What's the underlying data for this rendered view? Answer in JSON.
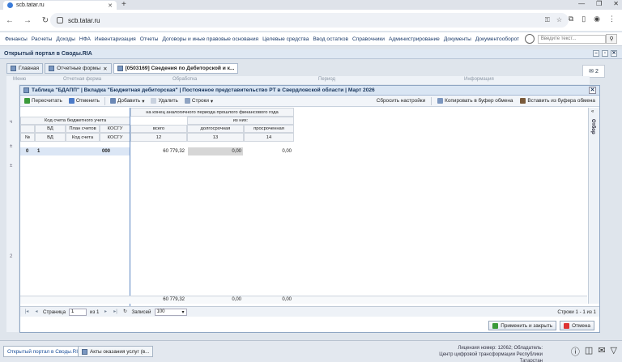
{
  "browser": {
    "tab_title": "scb.tatar.ru",
    "url": "scb.tatar.ru",
    "new_tab": "+"
  },
  "appnav": {
    "items": [
      "Финансы",
      "Расчеты",
      "Доходы",
      "НФА",
      "Инвентаризация",
      "Отчеты",
      "Договоры и иные правовые основания",
      "Целевые средства",
      "Ввод остатков",
      "Справочники",
      "Администрирование",
      "Документы",
      "Документооборот"
    ],
    "search_placeholder": "Введите текст..."
  },
  "portal_title": "Открытый портал в Своды.RIA",
  "inner_tabs": [
    {
      "label": "Главная"
    },
    {
      "label": "Отчетные формы"
    },
    {
      "label": "[0503169] Сведения по Дебиторской и к..."
    }
  ],
  "messages_count": "2",
  "bg_headers": [
    "Меню",
    "Отчетная форма",
    "Обработка",
    "Период",
    "Информация"
  ],
  "window": {
    "title": "Таблица \"БДАПП\" | Вкладка \"Бюджетная дебиторская\" | Постоянное представительство РТ в Свердловской области | Март 2026",
    "toolbar": {
      "recalc": "Пересчитать",
      "undo": "Отменить",
      "add": "Добавить",
      "delete": "Удалить",
      "rows": "Строки",
      "reset": "Сбросить настройки",
      "copy": "Копировать в буфер обмена",
      "paste": "Вставить из буфера обмена"
    },
    "side_label": "Отбор",
    "grid": {
      "group_top": "на конец аналогичного периода прошлого финансового года",
      "group_left": "Код счета бюджетного учета",
      "sub_of_which": "из них:",
      "col_num": "№",
      "col_vd": "ВД",
      "col_plan": "План счетов",
      "col_kosgu": "КОСГУ",
      "col_total": "всего",
      "col_long": "долгосрочная",
      "col_overdue": "просроченная",
      "code_vd": "ВД",
      "code_account": "Код счета",
      "code_kosgu": "КОСГУ",
      "num_total": "12",
      "num_long": "13",
      "num_overdue": "14",
      "row": {
        "num": "0",
        "vd": "1",
        "kosgu": "000",
        "total": "60 779,32",
        "long": "0,00",
        "overdue": "0,00"
      },
      "totals": {
        "total": "60 779,32",
        "long": "0,00",
        "overdue": "0,00"
      }
    },
    "pager": {
      "page_label": "Страница",
      "page_value": "1",
      "of_pages": "из 1",
      "records_label": "Записей",
      "page_size": "100",
      "status": "Строки 1 - 1 из 1"
    },
    "buttons": {
      "apply": "Применить и закрыть",
      "cancel": "Отмена"
    }
  },
  "taskbar": {
    "tasks": [
      "Открытый портал в Своды.RIA",
      "Акты оказания услуг (в..."
    ],
    "license": "Лицензия номер: 12062; Обладатель:",
    "center": "Центр цифровой трансформации Республики Татарстан"
  }
}
